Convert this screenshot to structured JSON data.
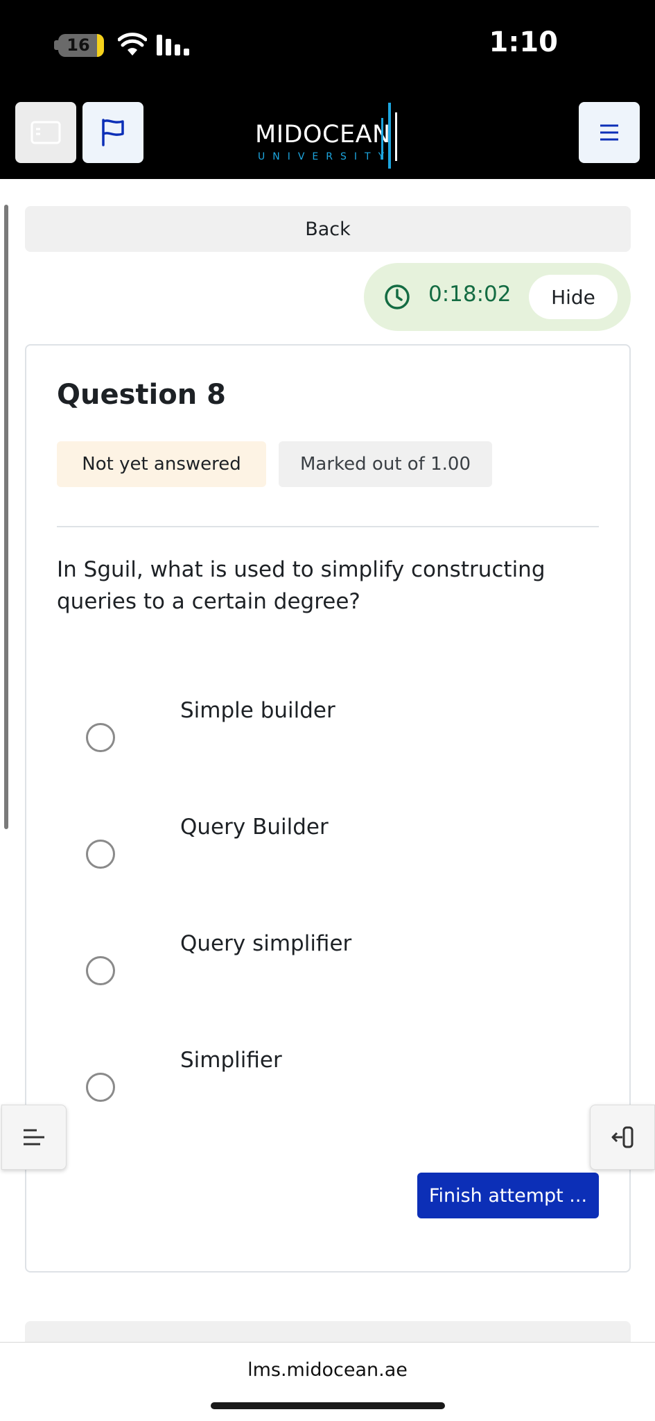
{
  "status_bar": {
    "battery": "16",
    "time": "1:10"
  },
  "header": {
    "logo_text": "MIDOCEAN",
    "logo_subtext": "UNIVERSITY",
    "accent_color": "#1da6df"
  },
  "nav": {
    "back_label": "Back"
  },
  "timer": {
    "time": "0:18:02",
    "hide_label": "Hide",
    "color": "#146c43"
  },
  "question": {
    "title": "Question 8",
    "state": "Not yet answered",
    "grade": "Marked out of 1.00",
    "text": "In Sguil, what is used to simplify constructing queries to a certain degree?",
    "options": [
      {
        "label": "Simple builder"
      },
      {
        "label": "Query Builder"
      },
      {
        "label": "Query simplifier"
      },
      {
        "label": "Simplifier"
      }
    ],
    "finish_label": "Finish attempt ...",
    "finish_color": "#0c2fb7"
  },
  "browser": {
    "url": "lms.midocean.ae"
  }
}
